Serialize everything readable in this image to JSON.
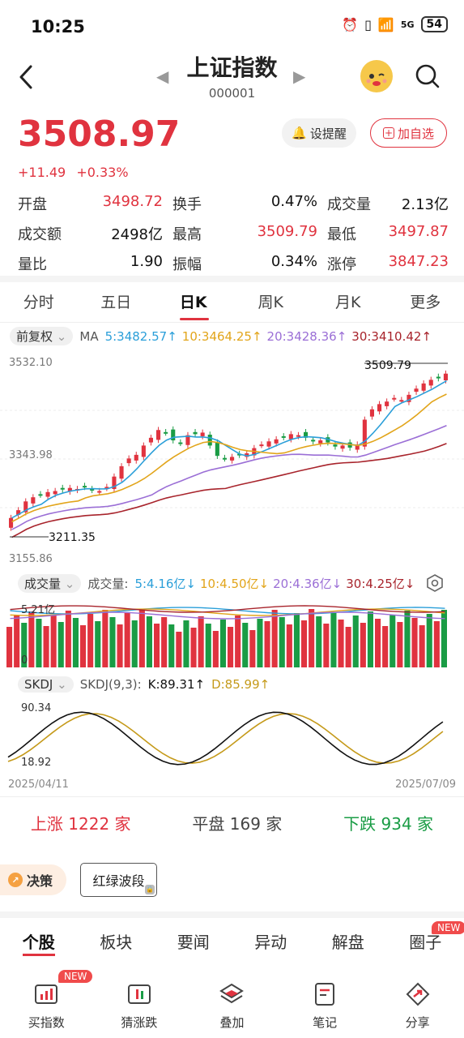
{
  "status": {
    "time": "10:25",
    "battery": "54",
    "network": "5G"
  },
  "header": {
    "title": "上证指数",
    "code": "000001"
  },
  "quote": {
    "price": "3508.97",
    "change": "+11.49",
    "change_pct": "+0.33%",
    "remind_label": "设提醒",
    "watch_label": "加自选"
  },
  "stats": [
    [
      {
        "label": "开盘",
        "value": "3498.72",
        "color": "red"
      },
      {
        "label": "换手",
        "value": "0.47%",
        "color": "black"
      },
      {
        "label": "成交量",
        "value": "2.13亿",
        "color": "black"
      }
    ],
    [
      {
        "label": "成交额",
        "value": "2498亿",
        "color": "black"
      },
      {
        "label": "最高",
        "value": "3509.79",
        "color": "red"
      },
      {
        "label": "最低",
        "value": "3497.87",
        "color": "red"
      }
    ],
    [
      {
        "label": "量比",
        "value": "1.90",
        "color": "black"
      },
      {
        "label": "振幅",
        "value": "0.34%",
        "color": "black"
      },
      {
        "label": "涨停",
        "value": "3847.23",
        "color": "red"
      }
    ]
  ],
  "tabs": [
    "分时",
    "五日",
    "日K",
    "周K",
    "月K",
    "更多"
  ],
  "ma_row": {
    "adjust": "前复权",
    "label": "MA",
    "items": [
      {
        "text": "5:3482.57↑",
        "color": "#2b9fd9"
      },
      {
        "text": "10:3464.25↑",
        "color": "#e2a51b"
      },
      {
        "text": "20:3428.36↑",
        "color": "#9b6fd6"
      },
      {
        "text": "30:3410.42↑",
        "color": "#a8242c"
      }
    ]
  },
  "kline": {
    "top_label": "3532.10",
    "mid_label": "3343.98",
    "bottom_label": "3155.86",
    "high_mark": "3509.79",
    "low_mark": "3211.35"
  },
  "volume_row": {
    "selector": "成交量",
    "label": "成交量:",
    "items": [
      {
        "text": "5:4.16亿↓",
        "color": "#2b9fd9"
      },
      {
        "text": "10:4.50亿↓",
        "color": "#e2a51b"
      },
      {
        "text": "20:4.36亿↓",
        "color": "#9b6fd6"
      },
      {
        "text": "30:4.25亿↓",
        "color": "#a8242c"
      }
    ],
    "top_label": "5.21亿",
    "zero_label": "0"
  },
  "kdj_row": {
    "selector": "SKDJ",
    "label": "SKDJ(9,3):",
    "k": "K:89.31↑",
    "d": "D:85.99↑",
    "top_label": "90.34",
    "bottom_label": "18.92"
  },
  "dates": {
    "start": "2025/04/11",
    "end": "2025/07/09"
  },
  "breadth": {
    "up": "上涨 1222 家",
    "flat": "平盘 169 家",
    "down": "下跌 934 家"
  },
  "decision": {
    "label": "决策",
    "wave_label": "红绿波段"
  },
  "news_tabs": [
    "个股",
    "板块",
    "要闻",
    "异动",
    "解盘",
    "圈子"
  ],
  "new_badge": "NEW",
  "bottom_nav": [
    "买指数",
    "猜涨跌",
    "叠加",
    "笔记",
    "分享"
  ],
  "colors": {
    "up": "#e0333f",
    "down": "#1a9c45",
    "ma5": "#2b9fd9",
    "ma10": "#e2a51b",
    "ma20": "#9b6fd6",
    "ma30": "#a8242c"
  }
}
